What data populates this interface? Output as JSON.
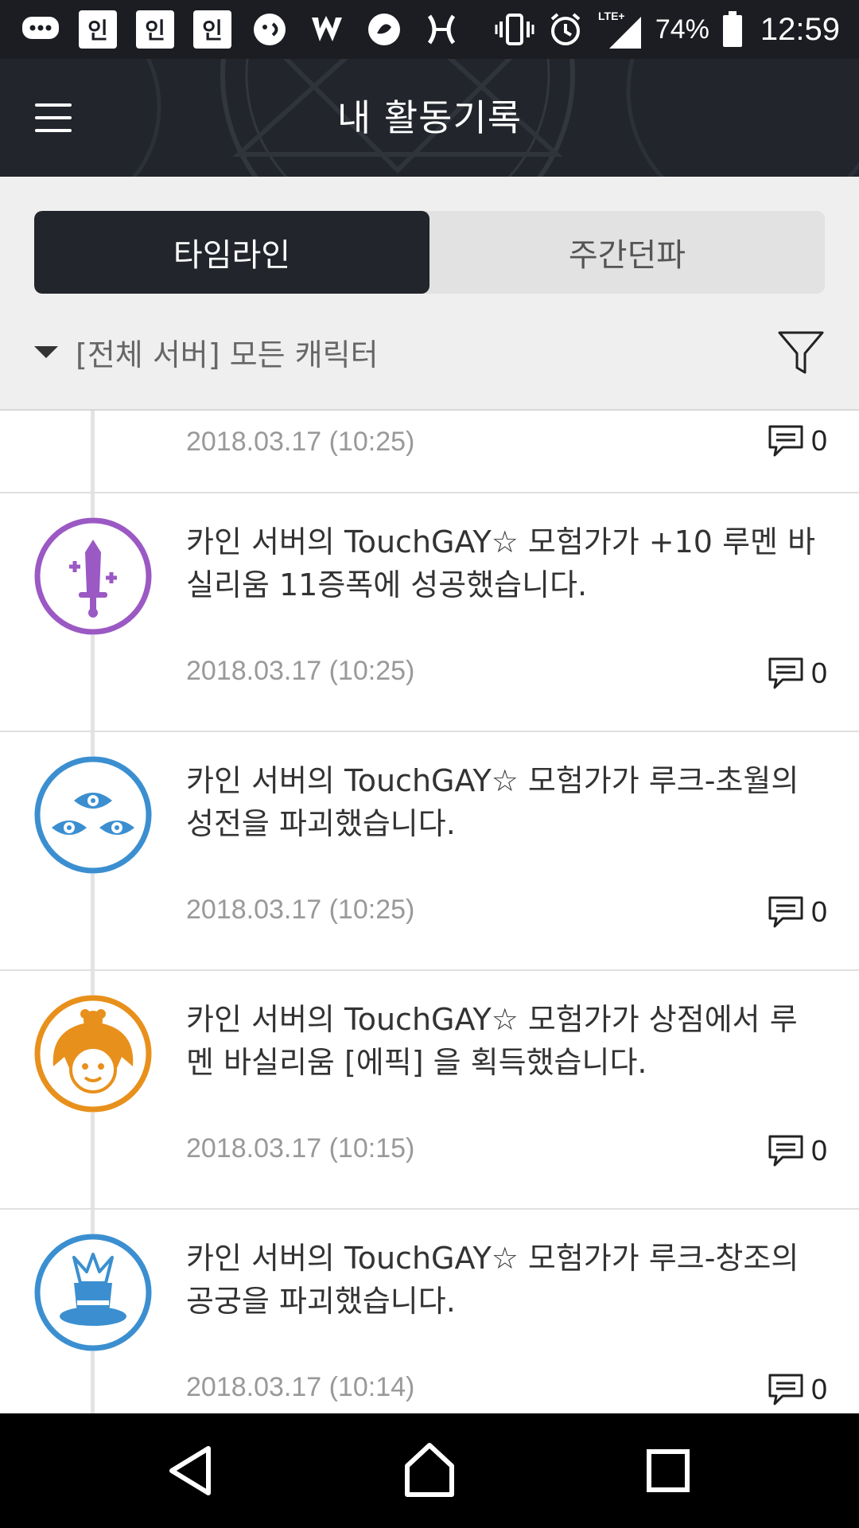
{
  "status_bar": {
    "left_icons": [
      "messages-icon",
      "notification-app-icon",
      "notification-app-icon",
      "notification-app-icon",
      "chat-app-icon",
      "app-notification-icon",
      "app-notification-icon",
      "app-notification-icon"
    ],
    "app_icon_char": "인",
    "network": "LTE+",
    "battery": "74%",
    "time": "12:59"
  },
  "header": {
    "title": "내 활동기록",
    "menu_icon": "hamburger-menu-icon"
  },
  "tabs": [
    {
      "label": "타임라인",
      "active": true
    },
    {
      "label": "주간던파",
      "active": false
    }
  ],
  "server_filter": {
    "label": "[전체 서버] 모든 캐릭터",
    "filter_icon": "funnel-filter-icon"
  },
  "feed": {
    "partial_item": {
      "date": "2018.03.17 (10:25)",
      "comments": "0"
    },
    "items": [
      {
        "icon": "sword-icon",
        "icon_color": "#9b59c4",
        "text": "카인 서버의 TouchGAY☆ 모험가가 +10 루멘 바실리움 11증폭에 성공했습니다.",
        "date": "2018.03.17 (10:25)",
        "comments": "0"
      },
      {
        "icon": "three-eyes-icon",
        "icon_color": "#3b8fd0",
        "text": "카인 서버의 TouchGAY☆ 모험가가 루크-초월의 성전을 파괴했습니다.",
        "date": "2018.03.17 (10:25)",
        "comments": "0"
      },
      {
        "icon": "character-face-icon",
        "icon_color": "#e8901c",
        "text": "카인 서버의 TouchGAY☆ 모험가가 상점에서 루멘 바실리움 [에픽] 을 획득했습니다.",
        "date": "2018.03.17 (10:15)",
        "comments": "0"
      },
      {
        "icon": "top-hat-icon",
        "icon_color": "#3b8fd0",
        "text": "카인 서버의 TouchGAY☆ 모험가가 루크-창조의 공궁을 파괴했습니다.",
        "date": "2018.03.17 (10:14)",
        "comments": "0"
      }
    ]
  },
  "nav_bar": {
    "buttons": [
      "back-triangle-icon",
      "home-icon",
      "recents-square-icon"
    ]
  },
  "colors": {
    "header_bg": "#22252c",
    "active_tab_bg": "#22252c",
    "control_bg": "#efefef",
    "purple": "#9b59c4",
    "blue": "#3b8fd0",
    "orange": "#e8901c"
  }
}
